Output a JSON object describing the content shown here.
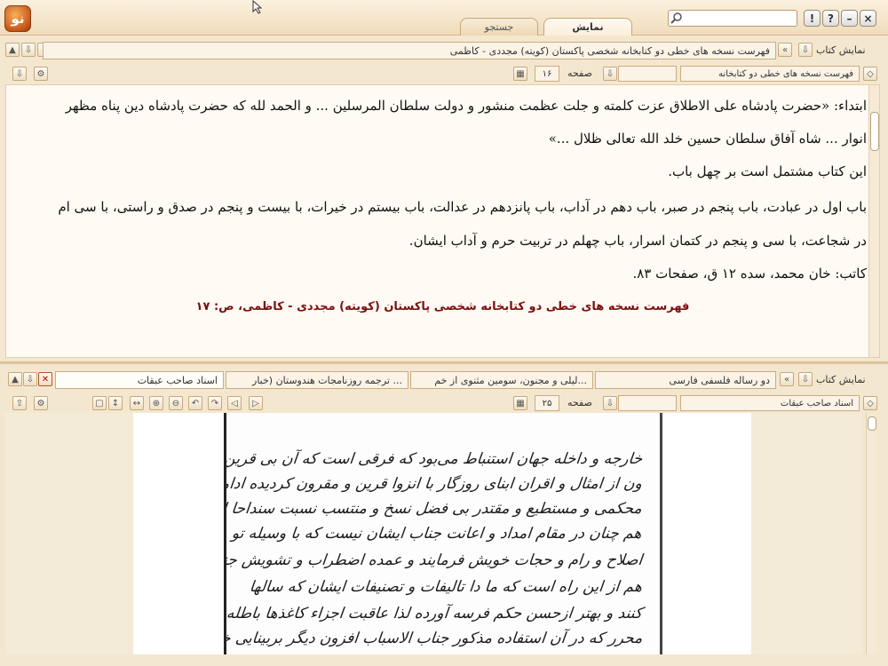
{
  "app": {
    "logo_text": "نو",
    "tabs": {
      "display": "نمایش",
      "search": "جستجو"
    },
    "search": {
      "value": ""
    },
    "window_buttons": {
      "help": "?",
      "info": "!",
      "minimize": "–",
      "close": "×"
    }
  },
  "top_panel": {
    "show_book_label": "نمایش کتاب",
    "book_title_field": "فهرست نسخه های خطی دو کتابخانه شخصی پاکستان (کویته) مجددی - کاظمی",
    "book_selector": "فهرست نسخه های خطی دو کتابخانه",
    "page_label": "صفحه",
    "page_number": "۱۶",
    "paragraphs": [
      "ابتداء: «حضرت پادشاه علی الاطلاق عزت کلمته و جلت عظمت منشور و دولت سلطان المرسلین ... و الحمد لله که حضرت پادشاه دین پناه مظهر",
      "انوار ... شاه آفاق سلطان حسین خلد الله تعالی ظلال ...»",
      "این کتاب مشتمل است بر چهل باب.",
      "باب اول در عبادت، باب پنجم در صبر، باب دهم در آداب، باب پانزدهم در عدالت، باب بیستم در خیرات، با بیست و پنجم در صدق و راستی، با سی ام",
      "در شجاعت، با سی و پنجم در کتمان اسرار، باب چهلم در تربیت حرم و آداب ایشان.",
      "کاتب: خان محمد، سده ۱۲ ق، صفحات ۸۳."
    ],
    "citation": "فهرست نسخه های خطی دو کتابخانه شخصی پاکستان (کویته) مجددی - کاظمی، ص: ۱۷"
  },
  "bottom_panel": {
    "show_book_label": "نمایش کتاب",
    "open_tabs": [
      "دو رساله فلسفی فارسی",
      "لیلی و مجنون، سومین مثنوی از خم...",
      "ترجمه روزنامجات هندوستان (خبار ...",
      "اسناد صاحب عبقات"
    ],
    "book_selector": "اسناد صاحب عبقات",
    "page_label": "صفحه",
    "page_number": "۲۵",
    "manuscript_lines": [
      "خارجه و داخله جهان استنباط می‌بود که فرقی است که آن بی قرین چون دانیس",
      "ون از امثال و اقران ابنای روزگار با انزوا قرین و مقرون کردیده ادامه",
      "محکمی و مستطیع و مقتدر بی فضل نسخ و منتسب نسبت سنداحا لی افتخار",
      "هم چنان در مقام امداد و اعانت جناب ایشان نیست که با وسیله تو",
      "اصلاح و رام و حجات خویش فرمایند و عمده اضطراب و تشویش جناب",
      "هم از این راه است که ما دا تالیفات و تصنیفات ایشان که سالها",
      "کنند و بهتر ازحسن حکم فرسه آورده لذا عاقبت اجزاء کاغذها باطله",
      "محرر که در آن استفاده مذکور جناب الاسباب افزون دیگر بربینایی خاطر"
    ]
  }
}
